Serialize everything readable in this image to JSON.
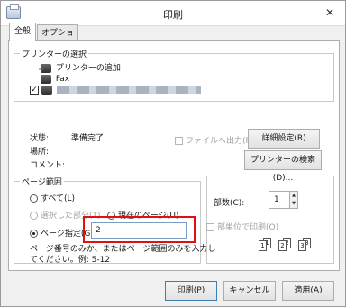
{
  "window": {
    "title": "印刷",
    "close_glyph": "✕"
  },
  "tabs": [
    {
      "label": "全般"
    },
    {
      "label": "オプション"
    }
  ],
  "printer_select": {
    "legend": "プリンターの選択",
    "items": [
      {
        "label": "プリンターの追加"
      },
      {
        "label": "Fax"
      }
    ]
  },
  "status": {
    "state_label": "状態:",
    "state_value": "準備完了",
    "location_label": "場所:",
    "comment_label": "コメント:",
    "file_output_label": "ファイルへ出力(F)",
    "details_button": "詳細設定(R)",
    "find_printer_button": "プリンターの検索(D)..."
  },
  "page_range": {
    "legend": "ページ範囲",
    "all": "すべて(L)",
    "selection": "選択した部分(T)",
    "current_page": "現在のページ(U)",
    "pages": "ページ指定(G)",
    "pages_value": "2",
    "hint_line1": "ページ番号のみか、またはページ範囲のみを入力し",
    "hint_line2": "てください。例: 5-12"
  },
  "copies": {
    "label": "部数(C):",
    "value": "1",
    "collate_label": "部単位で印刷(O)",
    "stack1": [
      "1",
      "1"
    ],
    "stack2": [
      "2",
      "2"
    ],
    "stack3": [
      "3",
      "3"
    ]
  },
  "buttons": {
    "print": "印刷(P)",
    "cancel": "キャンセル",
    "apply": "適用(A)"
  }
}
